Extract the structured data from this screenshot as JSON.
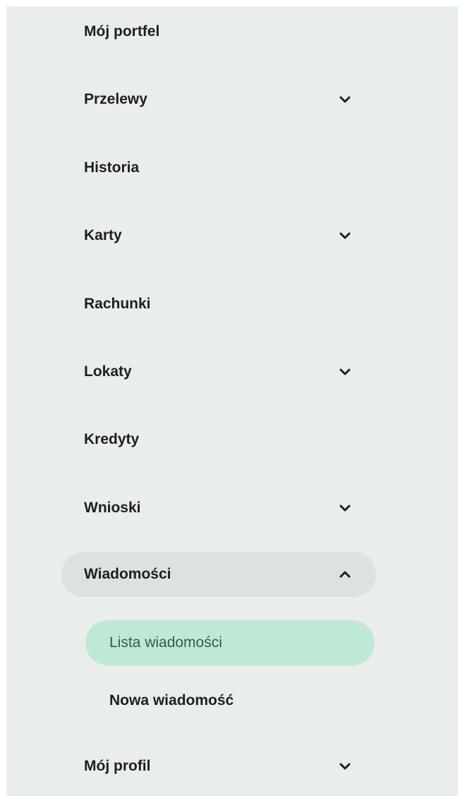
{
  "nav": {
    "items": [
      {
        "label": "Mój portfel"
      },
      {
        "label": "Przelewy",
        "chevron": "chevron-down-icon"
      },
      {
        "label": "Historia"
      },
      {
        "label": "Karty",
        "chevron": "chevron-down-icon"
      },
      {
        "label": "Rachunki"
      },
      {
        "label": "Lokaty",
        "chevron": "chevron-down-icon"
      },
      {
        "label": "Kredyty"
      },
      {
        "label": "Wnioski",
        "chevron": "chevron-down-icon"
      },
      {
        "label": "Wiadomości",
        "chevron": "chevron-up-icon",
        "expanded": true
      },
      {
        "label": "Mój profil",
        "chevron": "chevron-down-icon"
      }
    ],
    "messages_sub": [
      {
        "label": "Lista wiadomości",
        "active": true
      },
      {
        "label": "Nowa wiadomość"
      }
    ]
  },
  "colors": {
    "panel_bg": "#e9eeea",
    "expanded_bg": "#dce2de",
    "active_bg": "#bfe9d4",
    "active_text": "#355c4a",
    "text": "#1f1f1f"
  }
}
